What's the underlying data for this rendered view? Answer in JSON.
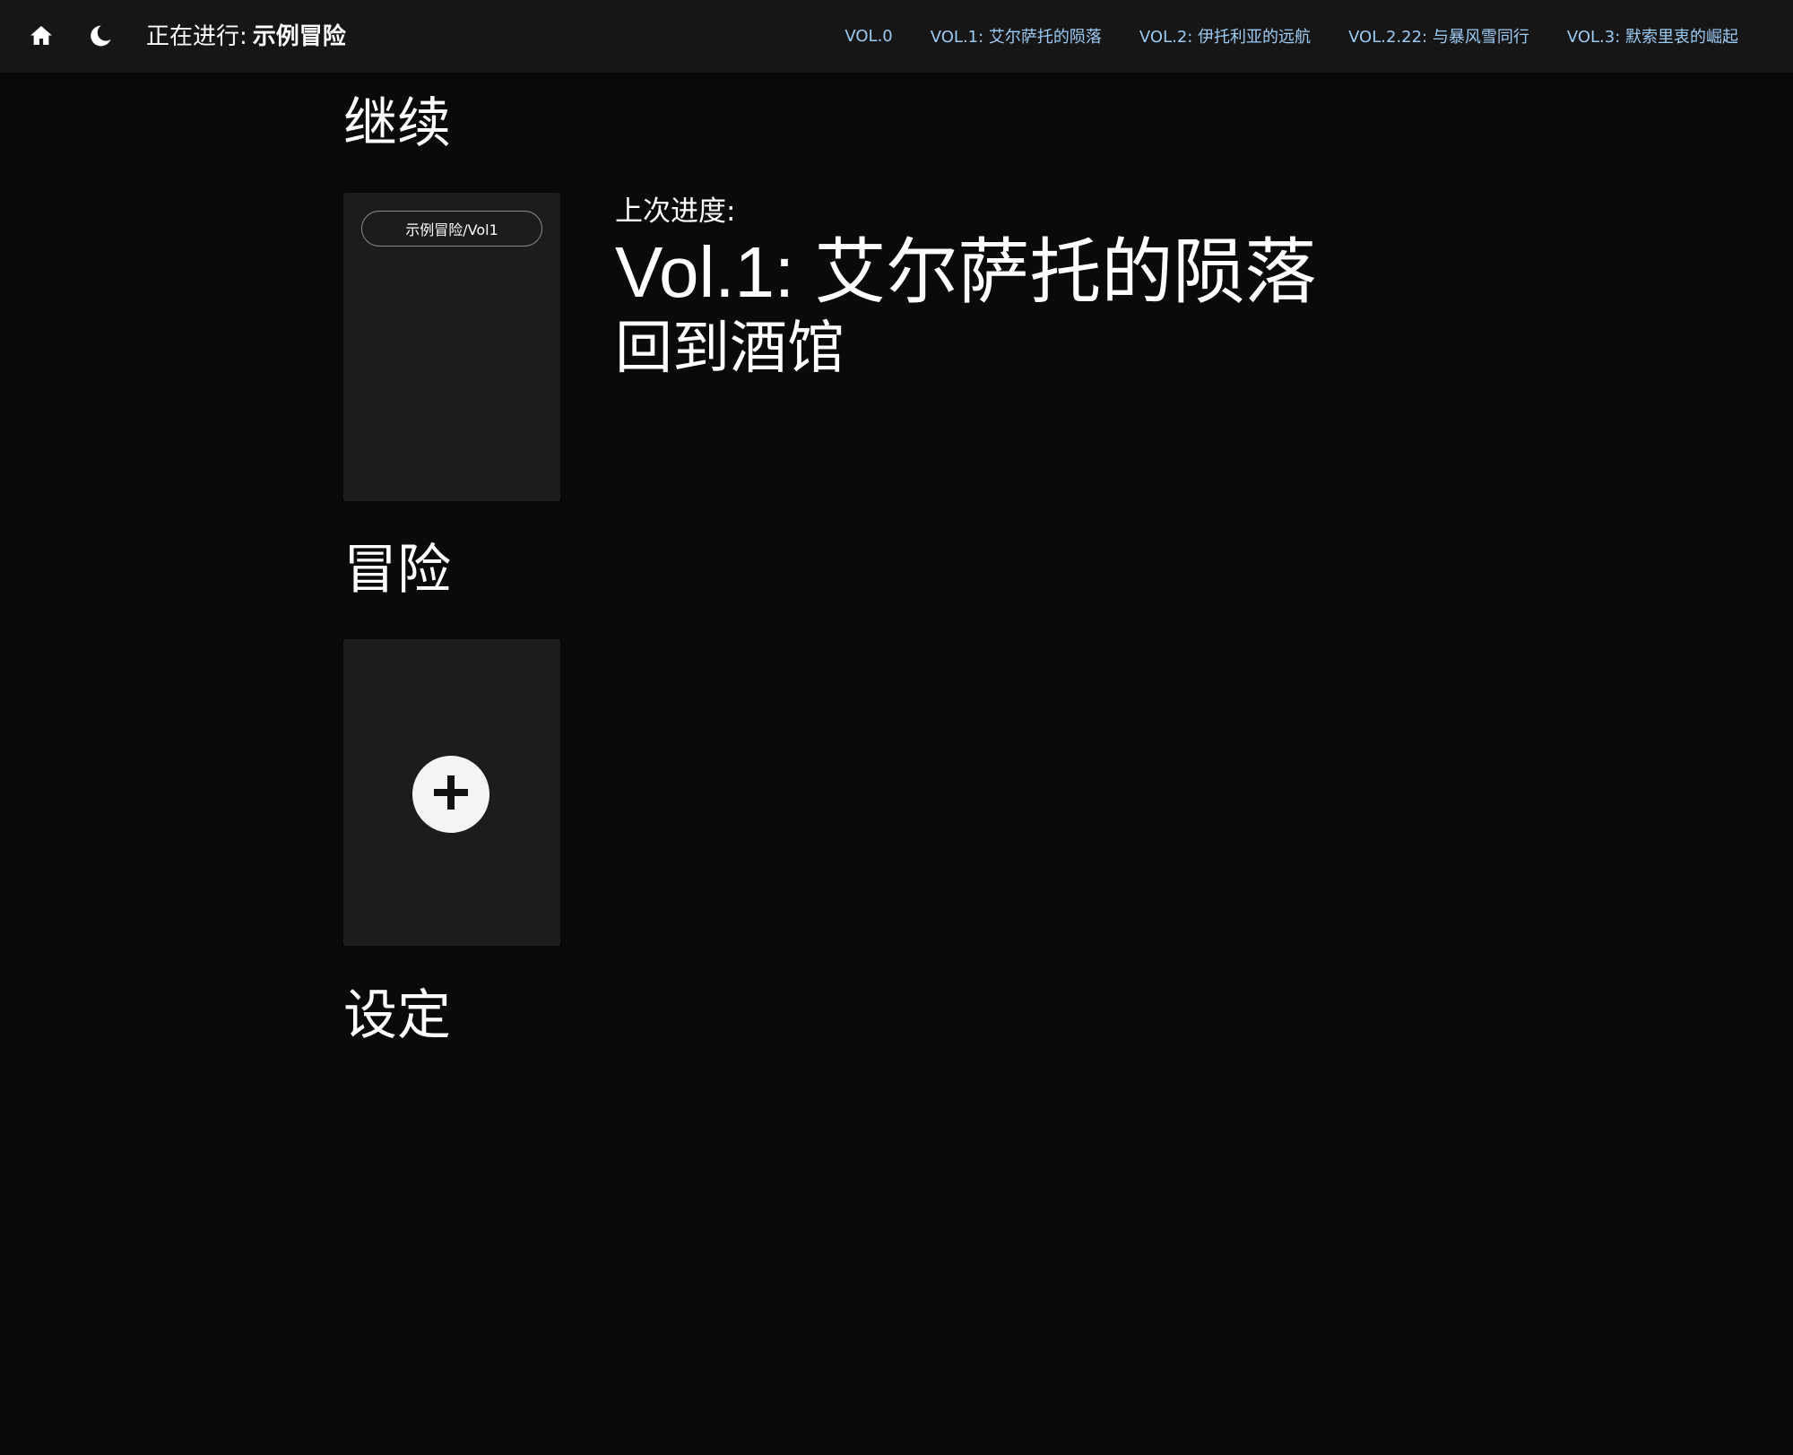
{
  "header": {
    "home_icon": "home-icon",
    "theme_icon": "moon-icon",
    "now_playing_label": "正在进行:",
    "now_playing_name": "示例冒险",
    "volumes": [
      "VOL.0",
      "VOL.1: 艾尔萨托的陨落",
      "VOL.2: 伊托利亚的远航",
      "VOL.2.22: 与暴风雪同行",
      "VOL.3: 默索里衷的崛起"
    ],
    "accent_color": "#9ccbf4"
  },
  "sections": {
    "continue_title": "继续",
    "adventure_title": "冒险",
    "settings_title": "设定"
  },
  "continue_card": {
    "chip_label": "示例冒险/Vol1"
  },
  "last_progress": {
    "label": "上次进度:",
    "volume": "Vol.1: 艾尔萨托的陨落",
    "chapter": "回到酒馆"
  },
  "adventure_card": {
    "add_icon": "plus-icon"
  }
}
